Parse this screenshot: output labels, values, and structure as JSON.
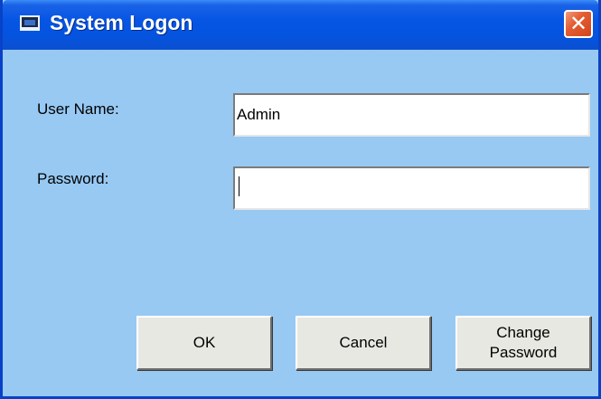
{
  "window": {
    "title": "System Logon",
    "app_icon": "window-app-icon",
    "close_glyph": "✕",
    "colors": {
      "titlebar": "#0655e4",
      "client_bg": "#97c9f3",
      "close_button": "#e45d32",
      "button_face": "#e8e8e3"
    }
  },
  "form": {
    "username": {
      "label": "User Name:",
      "value": "Admin"
    },
    "password": {
      "label": "Password:",
      "value": ""
    }
  },
  "buttons": {
    "ok": "OK",
    "cancel": "Cancel",
    "change_password_line1": "Change",
    "change_password_line2": "Password"
  }
}
